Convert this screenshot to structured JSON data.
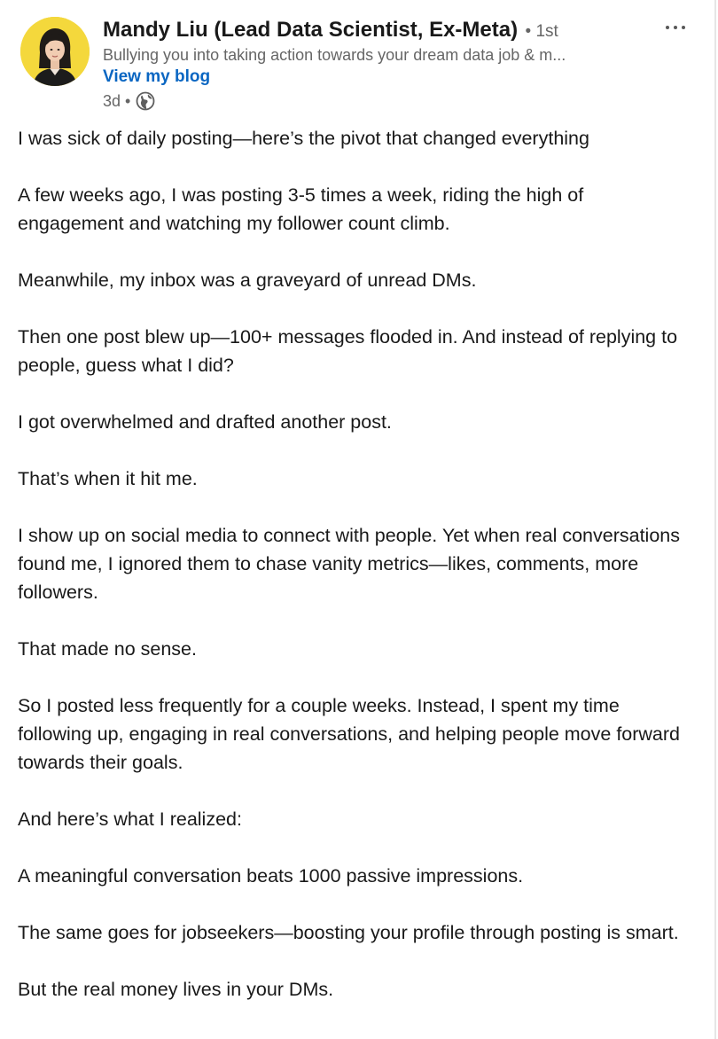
{
  "author": {
    "name": "Mandy Liu (Lead Data Scientist, Ex-Meta)",
    "degree": "• 1st",
    "headline": "Bullying you into taking action towards your dream data job & m...",
    "blog_link": "View my blog",
    "time": "3d •",
    "visibility_icon": "globe-icon",
    "more_icon": "more-options-icon"
  },
  "post": {
    "paragraphs": [
      "I was sick of daily posting—here’s the pivot that changed everything",
      "A few weeks ago, I was posting 3-5 times a week, riding the high of engagement and watching my follower count climb.",
      "Meanwhile, my inbox was a graveyard of unread DMs.",
      "Then one post blew up—100+ messages flooded in. And instead of replying to people, guess what I did?",
      "I got overwhelmed and drafted another post.",
      "That’s when it hit me.",
      "I show up on social media to connect with people. Yet when real conversations found me, I ignored them to chase vanity metrics—likes, comments, more followers.",
      "That made no sense.",
      "So I posted less frequently for a couple weeks. Instead, I spent my time following up, engaging in real conversations, and helping people move forward towards their goals.",
      "And here’s what I realized:",
      "A meaningful conversation beats 1000 passive impressions.",
      "The same goes for jobseekers—boosting your profile through posting is smart.",
      "But the real money lives in your DMs."
    ]
  },
  "colors": {
    "link": "#0a66c2",
    "avatar_bg": "#f4d83c",
    "secondary_text": "#666666",
    "primary_text": "#191919"
  }
}
